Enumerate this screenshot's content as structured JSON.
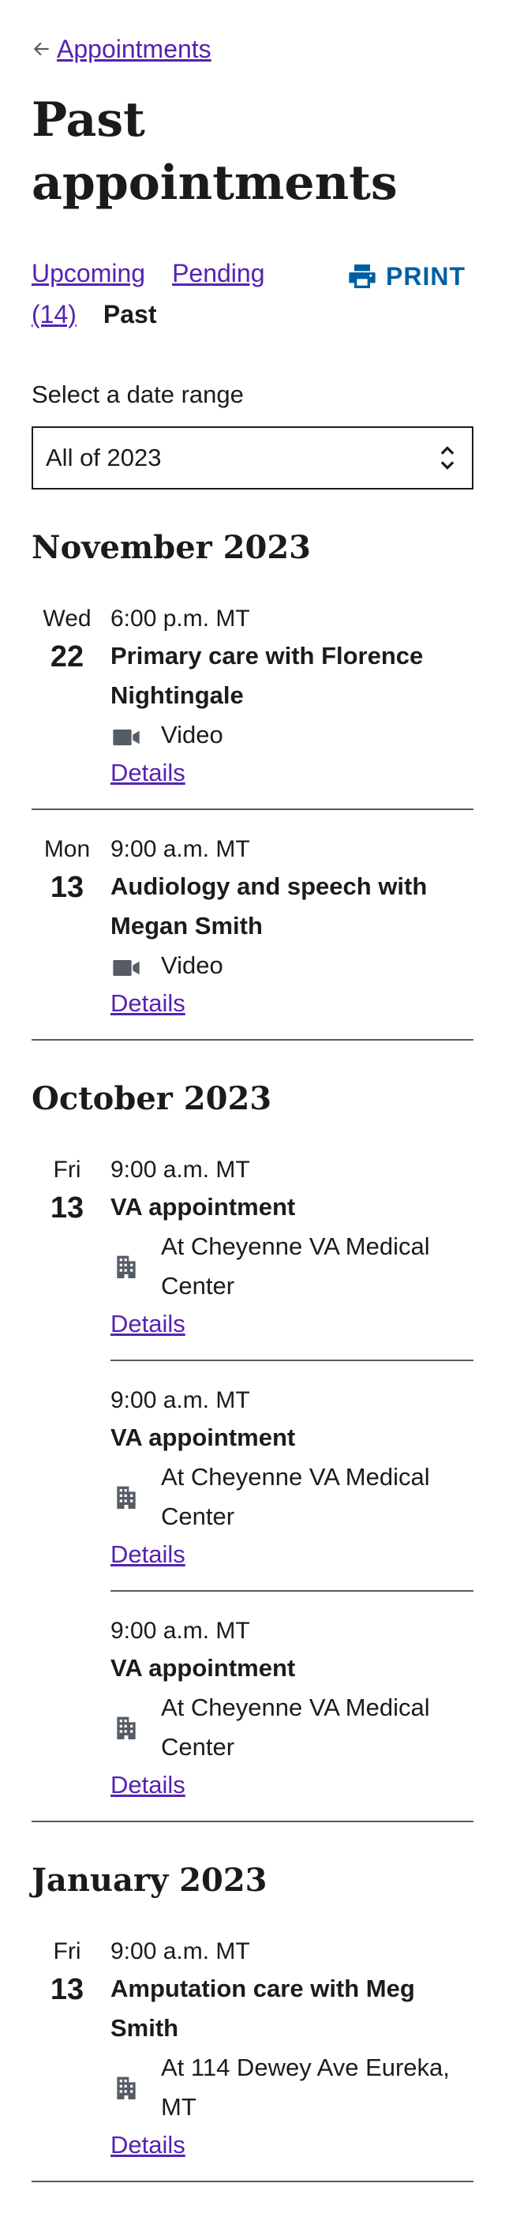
{
  "breadcrumb": {
    "label": "Appointments"
  },
  "page": {
    "title": "Past appointments"
  },
  "tabs": {
    "upcoming": "Upcoming",
    "pending": "Pending (14)",
    "past": "Past"
  },
  "print": {
    "label": "PRINT"
  },
  "date_range": {
    "label": "Select a date range",
    "selected": "All of 2023"
  },
  "colors": {
    "link": "#5522b3",
    "print": "#005ea2",
    "icon": "#565c65"
  },
  "months": [
    {
      "title": "November 2023",
      "days": [
        {
          "dow": "Wed",
          "day": "22",
          "appointments": [
            {
              "time": "6:00 p.m. MT",
              "title": "Primary care with Florence Nightingale",
              "icon": "video-icon",
              "kind": "Video",
              "details": "Details"
            }
          ]
        },
        {
          "dow": "Mon",
          "day": "13",
          "appointments": [
            {
              "time": "9:00 a.m. MT",
              "title": "Audiology and speech with Megan Smith",
              "icon": "video-icon",
              "kind": "Video",
              "details": "Details"
            }
          ]
        }
      ]
    },
    {
      "title": "October 2023",
      "days": [
        {
          "dow": "Fri",
          "day": "13",
          "appointments": [
            {
              "time": "9:00 a.m. MT",
              "title": "VA appointment",
              "icon": "building-icon",
              "kind": "At Cheyenne VA Medical Center",
              "details": "Details"
            },
            {
              "time": "9:00 a.m. MT",
              "title": "VA appointment",
              "icon": "building-icon",
              "kind": "At Cheyenne VA Medical Center",
              "details": "Details"
            },
            {
              "time": "9:00 a.m. MT",
              "title": "VA appointment",
              "icon": "building-icon",
              "kind": "At Cheyenne VA Medical Center",
              "details": "Details"
            }
          ]
        }
      ]
    },
    {
      "title": "January 2023",
      "days": [
        {
          "dow": "Fri",
          "day": "13",
          "appointments": [
            {
              "time": "9:00 a.m. MT",
              "title": "Amputation care with Meg Smith",
              "icon": "building-icon",
              "kind": "At 114 Dewey Ave Eureka, MT",
              "details": "Details"
            }
          ]
        }
      ]
    }
  ]
}
